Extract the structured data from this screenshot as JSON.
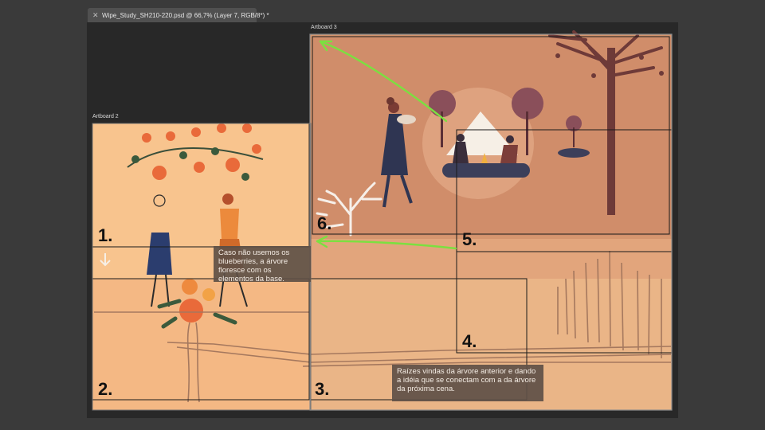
{
  "document": {
    "tab_title": "Wipe_Study_SH210-220.psd @ 66,7% (Layer 7, RGB/8*) *",
    "close_icon": "close-icon"
  },
  "artboards": {
    "artboard2_label": "Artboard 2",
    "artboard3_label": "Artboard 3"
  },
  "panel_numbers": [
    "1.",
    "2.",
    "3.",
    "4.",
    "5.",
    "6."
  ],
  "notes": {
    "note1": "Caso não usemos os blueberries, a árvore floresce com os elementos da base.",
    "note2": "Raízes vindas da árvore anterior e dando a idéia que se conectam com a da árvore da próxima cena."
  },
  "colors": {
    "ui_bg": "#3a3a3a",
    "workspace": "#282828",
    "artboard2_bg": "#f8c48e",
    "artboard3_bg": "#d89570",
    "arrow_green": "#7be040",
    "frame_line": "#1a1a1a"
  }
}
